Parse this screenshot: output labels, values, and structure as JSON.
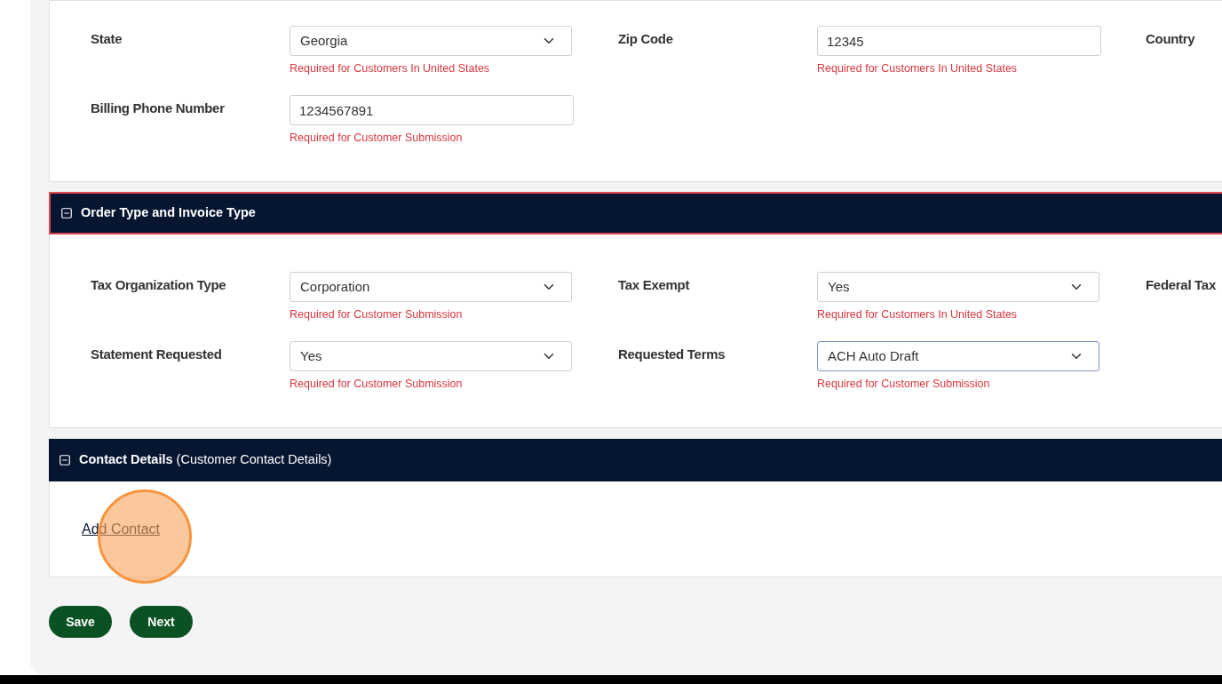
{
  "sections": [
    {
      "rows": [
        [
          {
            "label": "State",
            "kind": "select",
            "value": "Georgia",
            "hint": "Required for Customers In United States",
            "focused": false
          },
          {
            "label": "Zip Code",
            "kind": "text",
            "value": "12345",
            "hint": "Required for Customers In United States",
            "focused": false
          },
          {
            "label": "Country",
            "kind": "none"
          }
        ],
        [
          {
            "label": "Billing Phone Number",
            "kind": "text",
            "value": "1234567891",
            "hint": "Required for Customer Submission",
            "focused": false
          }
        ]
      ]
    },
    {
      "header": {
        "title": "Order Type and Invoice Type",
        "expanded": true,
        "highlighted": true
      },
      "rows": [
        [
          {
            "label": "Tax Organization Type",
            "kind": "select",
            "value": "Corporation",
            "hint": "Required for Customer Submission",
            "focused": false
          },
          {
            "label": "Tax Exempt",
            "kind": "select",
            "value": "Yes",
            "hint": "Required for Customers In United States",
            "focused": false
          },
          {
            "label": "Federal Tax",
            "kind": "none"
          }
        ],
        [
          {
            "label": "Statement Requested",
            "kind": "select",
            "value": "Yes",
            "hint": "Required for Customer Submission",
            "focused": false
          },
          {
            "label": "Requested Terms",
            "kind": "select",
            "value": "ACH Auto Draft",
            "hint": "Required for Customer Submission",
            "focused": true
          }
        ]
      ]
    },
    {
      "header": {
        "title": "Contact Details",
        "subtitle": "(Customer Contact Details)",
        "expanded": true,
        "highlighted": false
      },
      "link": "Add Contact"
    }
  ],
  "buttons": [
    "Save",
    "Next"
  ]
}
